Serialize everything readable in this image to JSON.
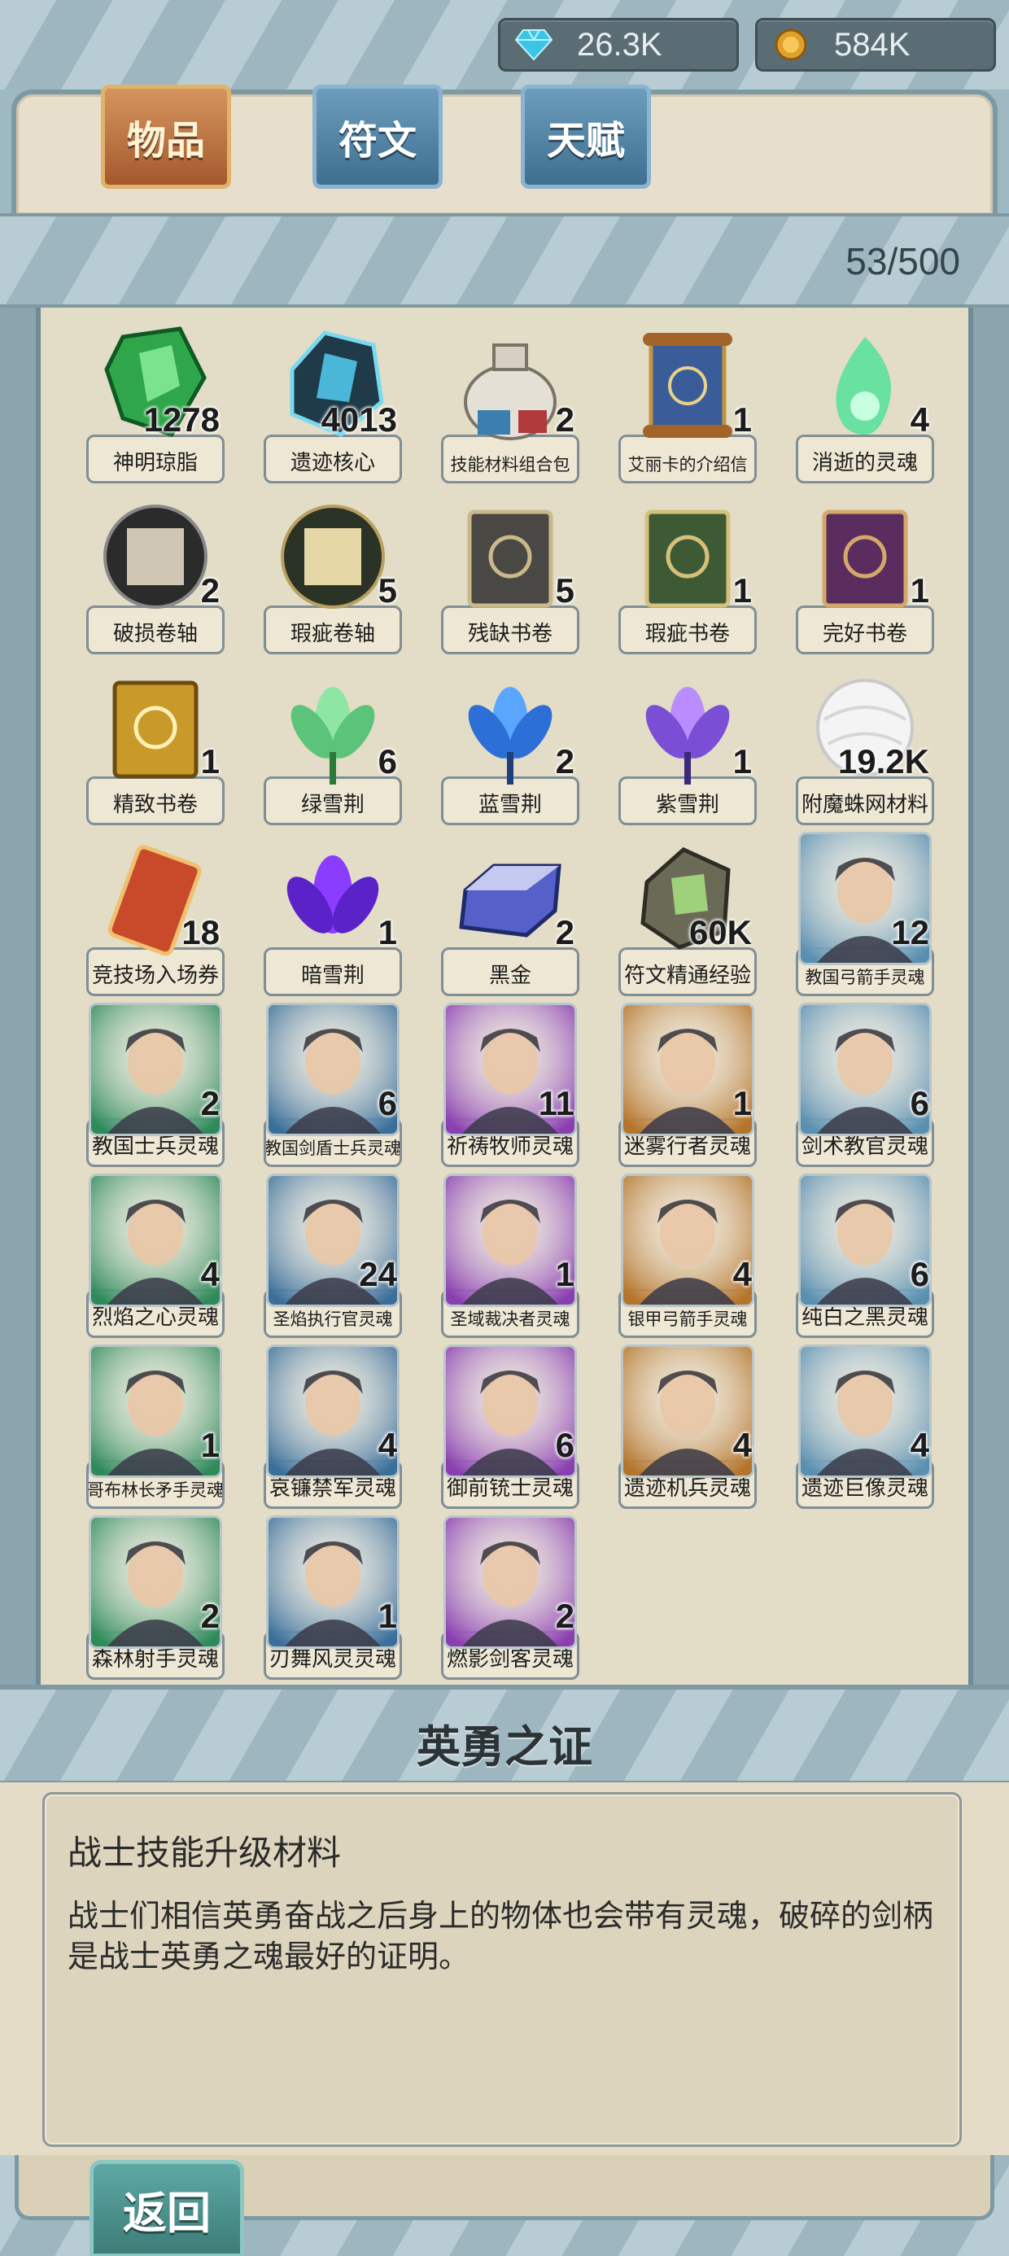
{
  "currencies": [
    {
      "icon": "diamond-icon",
      "value": "26.3K"
    },
    {
      "icon": "gold-coin-icon",
      "value": "584K"
    }
  ],
  "tabs": [
    {
      "label": "物品",
      "active": true
    },
    {
      "label": "符文",
      "active": false
    },
    {
      "label": "天赋",
      "active": false
    }
  ],
  "inventory": {
    "capacity": "53/500",
    "items": [
      {
        "name": "神明琼脂",
        "count": "1278",
        "icon": "green-gem-icon"
      },
      {
        "name": "遗迹核心",
        "count": "4013",
        "icon": "dark-crystal-icon"
      },
      {
        "name": "技能材料组合包",
        "count": "2",
        "icon": "sack-icon"
      },
      {
        "name": "艾丽卡的介绍信",
        "count": "1",
        "icon": "scroll-icon"
      },
      {
        "name": "消逝的灵魂",
        "count": "4",
        "icon": "green-flame-icon"
      },
      {
        "name": "破损卷轴",
        "count": "2",
        "icon": "torn-scroll-icon"
      },
      {
        "name": "瑕疵卷轴",
        "count": "5",
        "icon": "flawed-scroll-icon"
      },
      {
        "name": "残缺书卷",
        "count": "5",
        "icon": "gray-book-icon"
      },
      {
        "name": "瑕疵书卷",
        "count": "1",
        "icon": "green-book-icon"
      },
      {
        "name": "完好书卷",
        "count": "1",
        "icon": "purple-book-icon"
      },
      {
        "name": "精致书卷",
        "count": "1",
        "icon": "gold-book-icon"
      },
      {
        "name": "绿雪荆",
        "count": "6",
        "icon": "green-lotus-icon"
      },
      {
        "name": "蓝雪荆",
        "count": "2",
        "icon": "blue-lotus-icon"
      },
      {
        "name": "紫雪荆",
        "count": "1",
        "icon": "purple-lotus-icon"
      },
      {
        "name": "附魔蛛网材料",
        "count": "19.2K",
        "icon": "web-ball-icon"
      },
      {
        "name": "竞技场入场券",
        "count": "18",
        "icon": "ticket-icon"
      },
      {
        "name": "暗雪荆",
        "count": "1",
        "icon": "dark-lotus-icon"
      },
      {
        "name": "黑金",
        "count": "2",
        "icon": "ingot-icon"
      },
      {
        "name": "符文精通经验",
        "count": "60K",
        "icon": "rune-stone-icon"
      },
      {
        "name": "教国弓箭手灵魂",
        "count": "12",
        "icon": "archer-portrait-icon"
      },
      {
        "name": "教国士兵灵魂",
        "count": "2",
        "icon": "soldier-portrait-icon"
      },
      {
        "name": "教国剑盾士兵灵魂",
        "count": "6",
        "icon": "shield-soldier-portrait-icon"
      },
      {
        "name": "祈祷牧师灵魂",
        "count": "11",
        "icon": "priest-portrait-icon"
      },
      {
        "name": "迷雾行者灵魂",
        "count": "1",
        "icon": "mist-walker-portrait-icon"
      },
      {
        "name": "剑术教官灵魂",
        "count": "6",
        "icon": "sword-instructor-portrait-icon"
      },
      {
        "name": "烈焰之心灵魂",
        "count": "4",
        "icon": "flame-heart-portrait-icon"
      },
      {
        "name": "圣焰执行官灵魂",
        "count": "24",
        "icon": "holy-flame-portrait-icon"
      },
      {
        "name": "圣域裁决者灵魂",
        "count": "1",
        "icon": "sanctum-judge-portrait-icon"
      },
      {
        "name": "银甲弓箭手灵魂",
        "count": "4",
        "icon": "silver-archer-portrait-icon"
      },
      {
        "name": "纯白之黑灵魂",
        "count": "6",
        "icon": "white-black-portrait-icon"
      },
      {
        "name": "哥布林长矛手灵魂",
        "count": "1",
        "icon": "goblin-portrait-icon"
      },
      {
        "name": "哀镰禁军灵魂",
        "count": "4",
        "icon": "scythe-guard-portrait-icon"
      },
      {
        "name": "御前铳士灵魂",
        "count": "6",
        "icon": "gunner-portrait-icon"
      },
      {
        "name": "遗迹机兵灵魂",
        "count": "4",
        "icon": "ruin-mech-portrait-icon"
      },
      {
        "name": "遗迹巨像灵魂",
        "count": "4",
        "icon": "ruin-colossus-portrait-icon"
      },
      {
        "name": "森林射手灵魂",
        "count": "2",
        "icon": "forest-archer-portrait-icon"
      },
      {
        "name": "刃舞风灵灵魂",
        "count": "1",
        "icon": "blade-dancer-portrait-icon"
      },
      {
        "name": "燃影剑客灵魂",
        "count": "2",
        "icon": "shadow-swordsman-portrait-icon"
      }
    ]
  },
  "detail": {
    "title": "英勇之证",
    "type": "战士技能升级材料",
    "description": "战士们相信英勇奋战之后身上的物体也会带有灵魂，破碎的剑柄是战士英勇之魂最好的证明。"
  },
  "footer": {
    "back_label": "返回"
  }
}
